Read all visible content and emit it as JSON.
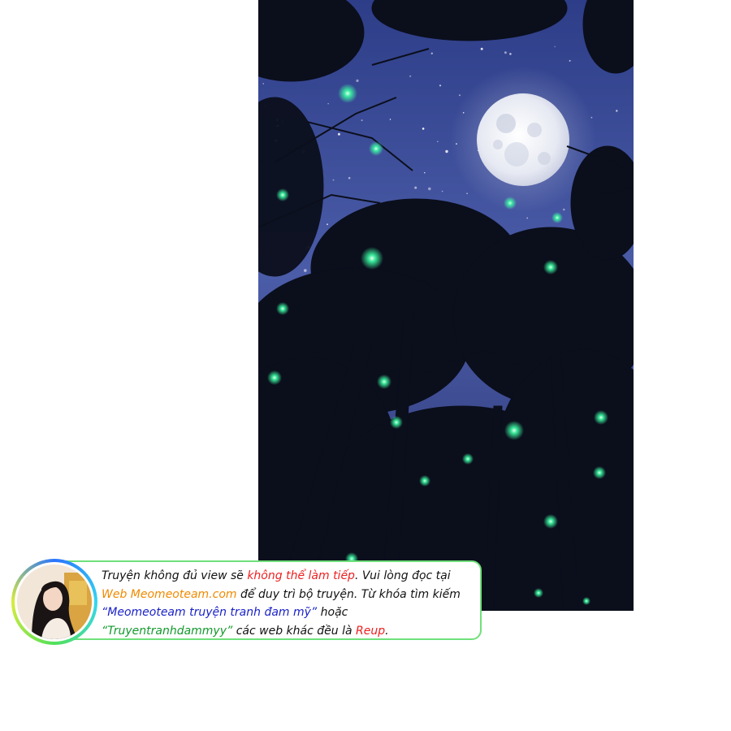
{
  "illustration": {
    "description_icon": "moonlit-forest-fireflies",
    "colors": {
      "sky_top": "#31428f",
      "sky_bottom": "#5668b3",
      "moon": "#eef0f6",
      "firefly": "#3dffa6",
      "trees": "#0b0f1c"
    }
  },
  "notice": {
    "line1": {
      "a": "Truyện không đủ view sẽ ",
      "b": "không thể làm tiếp",
      "c": ". Vui lòng đọc tại"
    },
    "line2": {
      "a": "Web Meomeoteam.com",
      "b": " để duy trì bộ truyện. Từ khóa tìm kiếm"
    },
    "line3": {
      "a": "“Meomeoteam truyện tranh đam mỹ”",
      "b": " hoặc"
    },
    "line4": {
      "a": "“Truyentranhdammyy”",
      "b": " các web khác đều là ",
      "c": "Reup",
      "d": "."
    },
    "colors": {
      "border": "#6fe07a",
      "red": "#ee2020",
      "orange": "#f08a00",
      "blue": "#1a22c8",
      "green": "#129a2c"
    }
  }
}
